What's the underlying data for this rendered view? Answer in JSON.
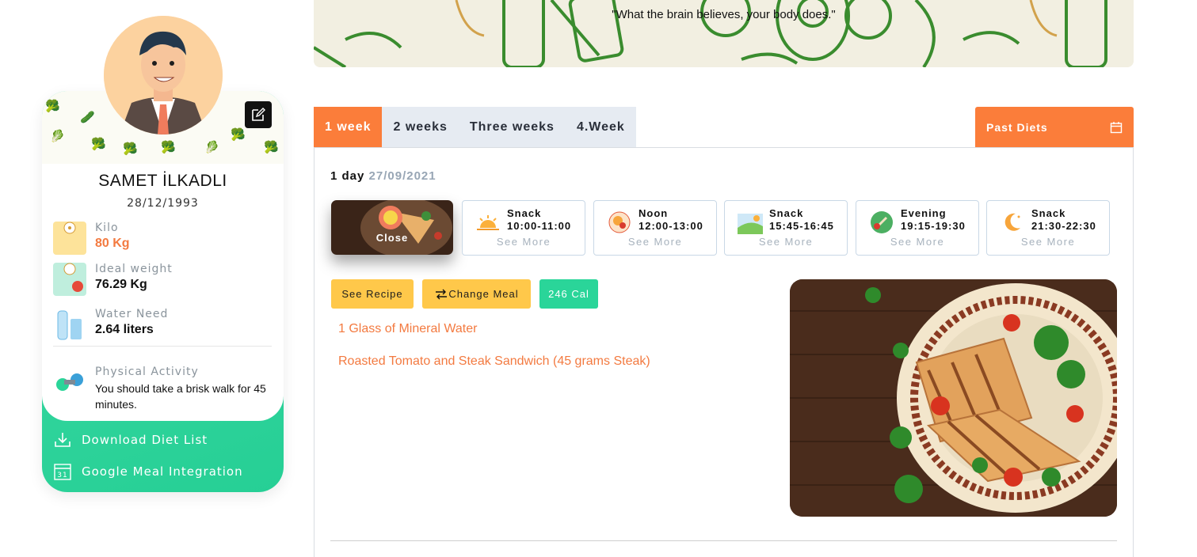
{
  "profile": {
    "name": "SAMET İLKADLI",
    "dob": "28/12/1993",
    "stats": [
      {
        "label": "Kilo",
        "value": "80 Kg",
        "accent": "#f37a40"
      },
      {
        "label": "Ideal weight",
        "value": "76.29 Kg",
        "accent": "#111111"
      },
      {
        "label": "Water Need",
        "value": "2.64 liters",
        "accent": "#111111"
      }
    ],
    "activity": {
      "label": "Physical Activity",
      "text": "You should take a brisk walk for 45 minutes."
    },
    "links": [
      {
        "label": "Download Diet List",
        "icon": "download-icon"
      },
      {
        "label": "Google Meal Integration",
        "icon": "calendar-31-icon",
        "calendar_day": "31"
      }
    ]
  },
  "banner": {
    "quote": "\"What the brain believes, your body does.\""
  },
  "tabs": [
    {
      "label": "1 week",
      "active": true
    },
    {
      "label": "2 weeks",
      "active": false
    },
    {
      "label": "Three weeks",
      "active": false
    },
    {
      "label": "4.Week",
      "active": false
    }
  ],
  "past_diets": {
    "label": "Past Diets",
    "icon": "calendar-icon"
  },
  "day": {
    "label": "1 day",
    "date": "27/09/2021"
  },
  "meals": {
    "active": {
      "label": "Close"
    },
    "items": [
      {
        "name": "Snack",
        "time": "10:00-11:00",
        "more": "See More",
        "icon": "sunrise-icon"
      },
      {
        "name": "Noon",
        "time": "12:00-13:00",
        "more": "See More",
        "icon": "lunch-plate-icon"
      },
      {
        "name": "Snack",
        "time": "15:45-16:45",
        "more": "See More",
        "icon": "landscape-icon"
      },
      {
        "name": "Evening",
        "time": "19:15-19:30",
        "more": "See More",
        "icon": "dinner-icon"
      },
      {
        "name": "Snack",
        "time": "21:30-22:30",
        "more": "See More",
        "icon": "moon-icon"
      }
    ]
  },
  "actions": {
    "see_recipe": "See Recipe",
    "change_meal": "Change Meal",
    "calories": "246 Cal"
  },
  "foods": [
    "1 Glass of Mineral Water",
    "Roasted Tomato and Steak Sandwich (45 grams Steak)"
  ],
  "colors": {
    "orange": "#fb7d3a",
    "green": "#2ad599",
    "yellow": "#ffc84a",
    "food_text": "#f37a40"
  }
}
